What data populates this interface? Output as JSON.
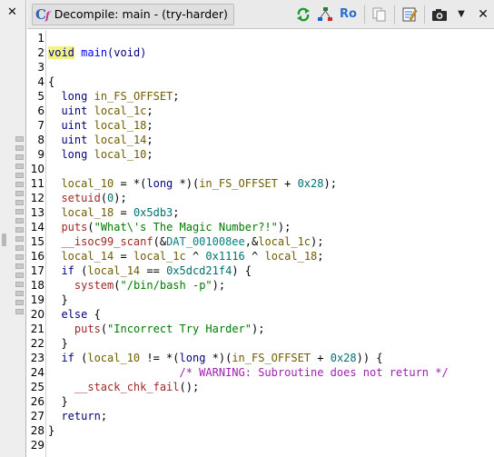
{
  "window": {
    "title": "Decompile: main -  (try-harder)",
    "left_close": "✕",
    "main_close": "✕",
    "ro_label": "Ro",
    "menu_arrow": "▼"
  },
  "colors": {
    "keyword": "#000080",
    "function": "#0000ff",
    "call": "#a02828",
    "variable": "#6e5c00",
    "global": "#008080",
    "number": "#007070",
    "string": "#007a00",
    "comment": "#a020b0",
    "highlight": "#f3f384"
  },
  "icons": [
    "decompile-icon",
    "refresh-icon",
    "graph-icon",
    "copy-icon",
    "edit-icon",
    "snapshot-icon",
    "menu-arrow-icon",
    "close-icon"
  ],
  "code": [
    {
      "n": "1",
      "t": [
        [
          "",
          ""
        ]
      ]
    },
    {
      "n": "2",
      "t": [
        [
          "kw-hl",
          "void"
        ],
        [
          "pl",
          " "
        ],
        [
          "fn",
          "main"
        ],
        [
          "kw",
          "(void)"
        ]
      ]
    },
    {
      "n": "3",
      "t": [
        [
          "",
          ""
        ]
      ]
    },
    {
      "n": "4",
      "t": [
        [
          "pl",
          "{"
        ]
      ]
    },
    {
      "n": "5",
      "t": [
        [
          "pl",
          "  "
        ],
        [
          "kw",
          "long"
        ],
        [
          "pl",
          " "
        ],
        [
          "var",
          "in_FS_OFFSET"
        ],
        [
          "pl",
          ";"
        ]
      ]
    },
    {
      "n": "6",
      "t": [
        [
          "pl",
          "  "
        ],
        [
          "kw",
          "uint"
        ],
        [
          "pl",
          " "
        ],
        [
          "var",
          "local_1c"
        ],
        [
          "pl",
          ";"
        ]
      ]
    },
    {
      "n": "7",
      "t": [
        [
          "pl",
          "  "
        ],
        [
          "kw",
          "uint"
        ],
        [
          "pl",
          " "
        ],
        [
          "var",
          "local_18"
        ],
        [
          "pl",
          ";"
        ]
      ]
    },
    {
      "n": "8",
      "t": [
        [
          "pl",
          "  "
        ],
        [
          "kw",
          "uint"
        ],
        [
          "pl",
          " "
        ],
        [
          "var",
          "local_14"
        ],
        [
          "pl",
          ";"
        ]
      ]
    },
    {
      "n": "9",
      "t": [
        [
          "pl",
          "  "
        ],
        [
          "kw",
          "long"
        ],
        [
          "pl",
          " "
        ],
        [
          "var",
          "local_10"
        ],
        [
          "pl",
          ";"
        ]
      ]
    },
    {
      "n": "10",
      "t": [
        [
          "",
          ""
        ]
      ]
    },
    {
      "n": "11",
      "t": [
        [
          "pl",
          "  "
        ],
        [
          "var",
          "local_10"
        ],
        [
          "pl",
          " = *("
        ],
        [
          "kw",
          "long"
        ],
        [
          "pl",
          " *)("
        ],
        [
          "var",
          "in_FS_OFFSET"
        ],
        [
          "pl",
          " + "
        ],
        [
          "num",
          "0x28"
        ],
        [
          "pl",
          ");"
        ]
      ]
    },
    {
      "n": "12",
      "t": [
        [
          "pl",
          "  "
        ],
        [
          "fnc",
          "setuid"
        ],
        [
          "pl",
          "("
        ],
        [
          "num",
          "0"
        ],
        [
          "pl",
          ");"
        ]
      ]
    },
    {
      "n": "13",
      "t": [
        [
          "pl",
          "  "
        ],
        [
          "var",
          "local_18"
        ],
        [
          "pl",
          " = "
        ],
        [
          "num",
          "0x5db3"
        ],
        [
          "pl",
          ";"
        ]
      ]
    },
    {
      "n": "14",
      "t": [
        [
          "pl",
          "  "
        ],
        [
          "fnc",
          "puts"
        ],
        [
          "pl",
          "("
        ],
        [
          "str",
          "\"What\\'s The Magic Number?!\""
        ],
        [
          "pl",
          ");"
        ]
      ]
    },
    {
      "n": "15",
      "t": [
        [
          "pl",
          "  "
        ],
        [
          "fnc",
          "__isoc99_scanf"
        ],
        [
          "pl",
          "(&"
        ],
        [
          "gvar",
          "DAT_001008ee"
        ],
        [
          "pl",
          ",&"
        ],
        [
          "var",
          "local_1c"
        ],
        [
          "pl",
          ");"
        ]
      ]
    },
    {
      "n": "16",
      "t": [
        [
          "pl",
          "  "
        ],
        [
          "var",
          "local_14"
        ],
        [
          "pl",
          " = "
        ],
        [
          "var",
          "local_1c"
        ],
        [
          "pl",
          " ^ "
        ],
        [
          "num",
          "0x1116"
        ],
        [
          "pl",
          " ^ "
        ],
        [
          "var",
          "local_18"
        ],
        [
          "pl",
          ";"
        ]
      ]
    },
    {
      "n": "17",
      "t": [
        [
          "pl",
          "  "
        ],
        [
          "kw",
          "if"
        ],
        [
          "pl",
          " ("
        ],
        [
          "var",
          "local_14"
        ],
        [
          "pl",
          " == "
        ],
        [
          "num",
          "0x5dcd21f4"
        ],
        [
          "pl",
          ") {"
        ]
      ]
    },
    {
      "n": "18",
      "t": [
        [
          "pl",
          "    "
        ],
        [
          "fnc",
          "system"
        ],
        [
          "pl",
          "("
        ],
        [
          "str",
          "\"/bin/bash -p\""
        ],
        [
          "pl",
          ");"
        ]
      ]
    },
    {
      "n": "19",
      "t": [
        [
          "pl",
          "  }"
        ]
      ]
    },
    {
      "n": "20",
      "t": [
        [
          "pl",
          "  "
        ],
        [
          "kw",
          "else"
        ],
        [
          "pl",
          " {"
        ]
      ]
    },
    {
      "n": "21",
      "t": [
        [
          "pl",
          "    "
        ],
        [
          "fnc",
          "puts"
        ],
        [
          "pl",
          "("
        ],
        [
          "str",
          "\"Incorrect Try Harder\""
        ],
        [
          "pl",
          ");"
        ]
      ]
    },
    {
      "n": "22",
      "t": [
        [
          "pl",
          "  }"
        ]
      ]
    },
    {
      "n": "23",
      "t": [
        [
          "pl",
          "  "
        ],
        [
          "kw",
          "if"
        ],
        [
          "pl",
          " ("
        ],
        [
          "var",
          "local_10"
        ],
        [
          "pl",
          " != *("
        ],
        [
          "kw",
          "long"
        ],
        [
          "pl",
          " *)("
        ],
        [
          "var",
          "in_FS_OFFSET"
        ],
        [
          "pl",
          " + "
        ],
        [
          "num",
          "0x28"
        ],
        [
          "pl",
          ")) {"
        ]
      ]
    },
    {
      "n": "24",
      "t": [
        [
          "pl",
          "                    "
        ],
        [
          "cmt",
          "/* WARNING: Subroutine does not return */"
        ]
      ]
    },
    {
      "n": "25",
      "t": [
        [
          "pl",
          "    "
        ],
        [
          "fnc",
          "__stack_chk_fail"
        ],
        [
          "pl",
          "();"
        ]
      ]
    },
    {
      "n": "26",
      "t": [
        [
          "pl",
          "  }"
        ]
      ]
    },
    {
      "n": "27",
      "t": [
        [
          "pl",
          "  "
        ],
        [
          "kw",
          "return"
        ],
        [
          "pl",
          ";"
        ]
      ]
    },
    {
      "n": "28",
      "t": [
        [
          "pl",
          "}"
        ]
      ]
    },
    {
      "n": "29",
      "t": [
        [
          "",
          ""
        ]
      ]
    }
  ]
}
